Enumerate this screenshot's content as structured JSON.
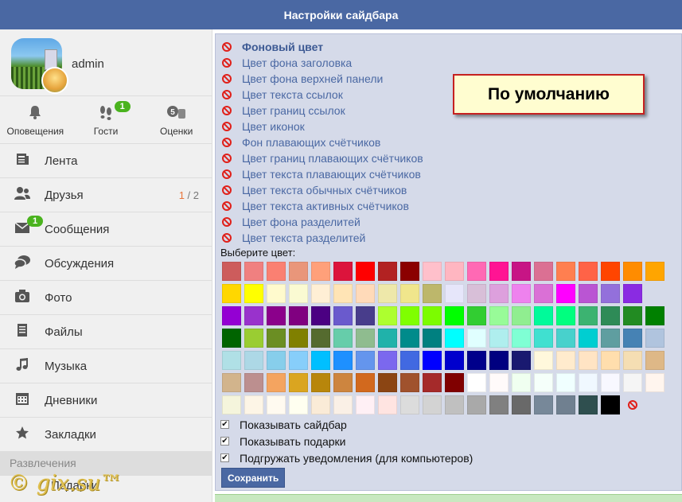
{
  "header": {
    "title": "Настройки сайдбара"
  },
  "profile": {
    "username": "admin"
  },
  "stats": [
    {
      "label": "Оповещения",
      "icon": "bell-icon",
      "badge": ""
    },
    {
      "label": "Гости",
      "icon": "footprints-icon",
      "badge": "1"
    },
    {
      "label": "Оценки",
      "icon": "rating-hand-icon",
      "badge": ""
    }
  ],
  "nav": {
    "feed": "Лента",
    "friends": "Друзья",
    "friends_count_online": "1",
    "friends_count_total": " / 2",
    "messages": "Сообщения",
    "messages_badge": "1",
    "discussions": "Обсуждения",
    "photos": "Фото",
    "files": "Файлы",
    "music": "Музыка",
    "diaries": "Дневники",
    "bookmarks": "Закладки",
    "section_entertainment": "Развлечения",
    "gifts": "Подарки"
  },
  "watermark": "© gix.su™",
  "settings": {
    "options": [
      "Фоновый цвет",
      "Цвет фона заголовка",
      "Цвет фона верхней панели",
      "Цвет текста ссылок",
      "Цвет границ ссылок",
      "Цвет иконок",
      "Фон плавающих счётчиков",
      "Цвет границ плавающих счётчиков",
      "Цвет текста плавающих счётчиков",
      "Цвет текста обычных счётчиков",
      "Цвет текста активных счётчиков",
      "Цвет фона разделитей",
      "Цвет текста разделитей"
    ],
    "default_button": "По умолчанию",
    "choose_color_label": "Выберите цвет:",
    "palette": [
      [
        "#cd5c5c",
        "#f08080",
        "#fa8072",
        "#e9967a",
        "#ffa07a",
        "#dc143c",
        "#ff0000",
        "#b22222",
        "#8b0000",
        "#ffc0cb",
        "#ffb6c1",
        "#ff69b4",
        "#ff1493",
        "#c71585",
        "#db7093",
        "#ff7f50",
        "#ff6347",
        "#ff4500",
        "#ff8c00",
        "#ffa500"
      ],
      [
        "#ffd700",
        "#ffff00",
        "#fffacd",
        "#fafad2",
        "#ffefd5",
        "#ffe4b5",
        "#ffdab9",
        "#eee8aa",
        "#f0e68c",
        "#bdb76b",
        "#e6e6fa",
        "#d8bfd8",
        "#dda0dd",
        "#ee82ee",
        "#da70d6",
        "#ff00ff",
        "#ba55d3",
        "#9370db",
        "#8a2be2"
      ],
      [
        "#9400d3",
        "#9932cc",
        "#8b008b",
        "#800080",
        "#4b0082",
        "#6a5acd",
        "#483d8b",
        "#adff2f",
        "#7fff00",
        "#7cfc00",
        "#00ff00",
        "#32cd32",
        "#98fb98",
        "#90ee90",
        "#00fa9a",
        "#00ff7f",
        "#3cb371",
        "#2e8b57",
        "#228b22",
        "#008000"
      ],
      [
        "#006400",
        "#9acd32",
        "#6b8e23",
        "#808000",
        "#556b2f",
        "#66cdaa",
        "#8fbc8f",
        "#20b2aa",
        "#008b8b",
        "#008080",
        "#00ffff",
        "#e0ffff",
        "#afeeee",
        "#7fffd4",
        "#40e0d0",
        "#48d1cc",
        "#00ced1",
        "#5f9ea0",
        "#4682b4",
        "#b0c4de"
      ],
      [
        "#b0e0e6",
        "#add8e6",
        "#87ceeb",
        "#87cefa",
        "#00bfff",
        "#1e90ff",
        "#6495ed",
        "#7b68ee",
        "#4169e1",
        "#0000ff",
        "#0000cd",
        "#00008b",
        "#000080",
        "#191970",
        "#fff8dc",
        "#ffebcd",
        "#ffe4c4",
        "#ffdead",
        "#f5deb3",
        "#deb887"
      ],
      [
        "#d2b48c",
        "#bc8f8f",
        "#f4a460",
        "#daa520",
        "#b8860b",
        "#cd853f",
        "#d2691e",
        "#8b4513",
        "#a0522d",
        "#a52a2a",
        "#800000",
        "#ffffff",
        "#fffafa",
        "#f0fff0",
        "#f5fffa",
        "#f0ffff",
        "#f0f8ff",
        "#f8f8ff",
        "#f5f5f5",
        "#fff5ee"
      ],
      [
        "#f5f5dc",
        "#fdf5e6",
        "#fffaf0",
        "#fffff0",
        "#faebd7",
        "#faf0e6",
        "#fff0f5",
        "#ffe4e1",
        "#dcdcdc",
        "#d3d3d3",
        "#c0c0c0",
        "#a9a9a9",
        "#808080",
        "#696969",
        "#778899",
        "#708090",
        "#2f4f4f",
        "#000000"
      ]
    ],
    "checkboxes": [
      {
        "label": "Показывать сайдбар",
        "checked": true
      },
      {
        "label": "Показывать подарки",
        "checked": true
      },
      {
        "label": "Подгружать уведомления (для компьютеров)",
        "checked": true
      }
    ],
    "save_button": "Сохранить",
    "check_mark": "✔"
  }
}
